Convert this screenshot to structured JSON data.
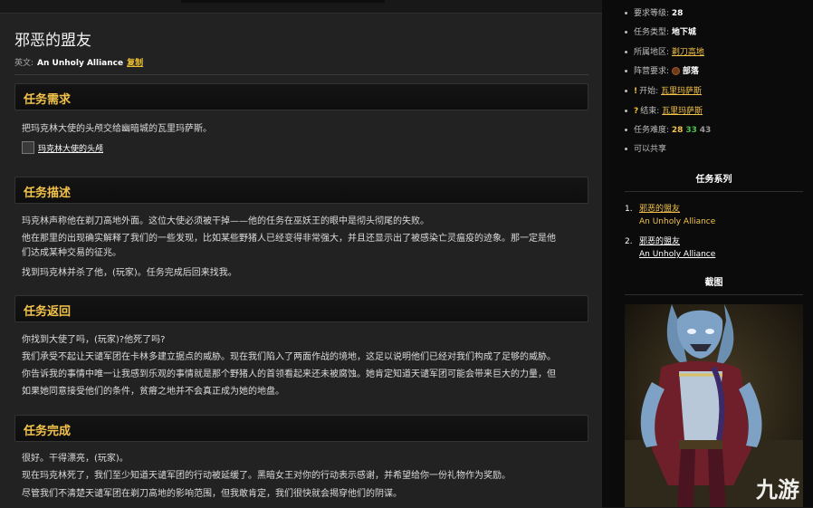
{
  "page": {
    "title": "邪恶的盟友",
    "english_label": "英文:",
    "english_name": "An Unholy Alliance",
    "copy_label": "复制"
  },
  "sections": {
    "requirement": {
      "heading": "任务需求",
      "text": "把玛克林大使的头颅交给幽暗城的瓦里玛萨斯。",
      "item_name": "玛克林大使的头颅"
    },
    "description": {
      "heading": "任务描述",
      "lines": [
        "玛克林声称他在剃刀高地外面。这位大使必须被干掉——他的任务在巫妖王的眼中是彻头彻尾的失败。",
        "他在那里的出现确实解释了我们的一些发现，比如某些野猪人已经变得非常强大，并且还显示出了被感染亡灵瘟疫的迹象。那一定是他",
        "们达成某种交易的征兆。",
        "找到玛克林并杀了他，(玩家)。任务完成后回来找我。"
      ]
    },
    "return": {
      "heading": "任务返回",
      "lines": [
        "你找到大使了吗，(玩家)?他死了吗?",
        "我们承受不起让天谴军团在卡林多建立据点的威胁。现在我们陷入了两面作战的境地，这足以说明他们已经对我们构成了足够的威胁。",
        "你告诉我的事情中唯一让我感到乐观的事情就是那个野猪人的首领看起来还未被腐蚀。她肯定知道天谴军团可能会带来巨大的力量，但",
        "如果她同意接受他们的条件，贫瘠之地并不会真正成为她的地盘。"
      ]
    },
    "complete": {
      "heading": "任务完成",
      "lines": [
        "很好。干得漂亮，(玩家)。",
        "现在玛克林死了，我们至少知道天谴军团的行动被延缓了。黑暗女王对你的行动表示感谢，并希望给你一份礼物作为奖励。",
        "尽管我们不清楚天谴军团在剃刀高地的影响范围，但我敢肯定，我们很快就会揭穿他们的阴谋。"
      ]
    }
  },
  "sidebar": {
    "level_req_label": "要求等级:",
    "level_req_value": "28",
    "type_label": "任务类型:",
    "type_value": "地下城",
    "zone_label": "所属地区:",
    "zone_value": "剃刀高地",
    "faction_label": "阵营要求:",
    "faction_value": "部落",
    "start_label": "开始:",
    "start_value": "瓦里玛萨斯",
    "end_label": "结束:",
    "end_value": "瓦里玛萨斯",
    "difficulty_label": "任务难度:",
    "difficulty_values": [
      "28",
      "33",
      "43"
    ],
    "shareable": "可以共享",
    "series_heading": "任务系列",
    "series": [
      {
        "num": "1.",
        "cn": "邪恶的盟友",
        "en": "An Unholy Alliance"
      },
      {
        "num": "2.",
        "cn": "邪恶的盟友",
        "en": "An Unholy Alliance"
      }
    ],
    "screenshot_heading": "截图",
    "watermark": "九游"
  },
  "colors": {
    "heading_gold": "#f2c24a",
    "green": "#4fbf4f",
    "gray": "#9a9a9a"
  }
}
